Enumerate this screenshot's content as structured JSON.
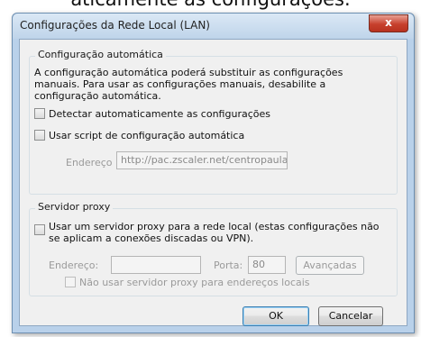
{
  "page_caption": "aticamente as configurações.",
  "dialog": {
    "title": "Configurações da Rede Local (LAN)",
    "close_glyph": "x",
    "auto_config": {
      "legend": "Configuração automática",
      "description_line1": "A configuração automática poderá substituir as configurações",
      "description_line2": "manuais. Para usar as configurações manuais, desabilite a",
      "description_line3": "configuração automática.",
      "detect_label": "Detectar automaticamente as configurações",
      "detect_checked": false,
      "script_label": "Usar script de configuração automática",
      "script_checked": false,
      "address_label": "Endereço",
      "address_value": "http://pac.zscaler.net/centropaula"
    },
    "proxy": {
      "legend": "Servidor proxy",
      "use_proxy_line1": "Usar um servidor proxy para a rede local (estas configurações não",
      "use_proxy_line2": "se aplicam a conexões discadas ou VPN).",
      "use_proxy_checked": false,
      "address_label": "Endereço:",
      "address_value": "",
      "port_label": "Porta:",
      "port_value": "80",
      "advanced_label": "Avançadas",
      "bypass_label": "Não usar servidor proxy para endereços locais",
      "bypass_checked": false
    },
    "ok_label": "OK",
    "cancel_label": "Cancelar"
  },
  "colors": {
    "frame": "#b9d1ea",
    "close_button": "#c7402d",
    "client_bg": "#f0f0f0",
    "disabled_text": "#9a9a9a"
  }
}
